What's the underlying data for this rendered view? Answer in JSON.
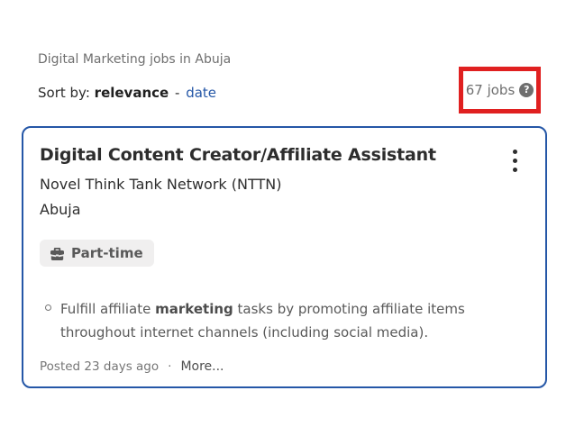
{
  "page": {
    "breadcrumb": "Digital Marketing jobs in Abuja",
    "sort": {
      "label": "Sort by:",
      "selected": "relevance",
      "separator": "-",
      "alternative": "date"
    },
    "job_count": "67 jobs",
    "help_icon_glyph": "?"
  },
  "annotation": {
    "type": "highlight-box",
    "color": "#e02020"
  },
  "job_card": {
    "title": "Digital Content Creator/Affiliate Assistant",
    "company": "Novel Think Tank Network (NTTN)",
    "location": "Abuja",
    "badge": {
      "icon": "briefcase-icon",
      "label": "Part-time"
    },
    "description": {
      "before": "Fulfill affiliate ",
      "highlight": "marketing",
      "after": " tasks by promoting affiliate items throughout internet channels (including social media)."
    },
    "footer": {
      "posted": "Posted 23 days ago",
      "separator": "·",
      "more": "More..."
    }
  },
  "colors": {
    "accent_blue": "#2557a7",
    "annotation_red": "#e02020",
    "text_dark": "#2d2d2d",
    "text_gray": "#6f6f6f",
    "badge_bg": "#f0efef"
  }
}
